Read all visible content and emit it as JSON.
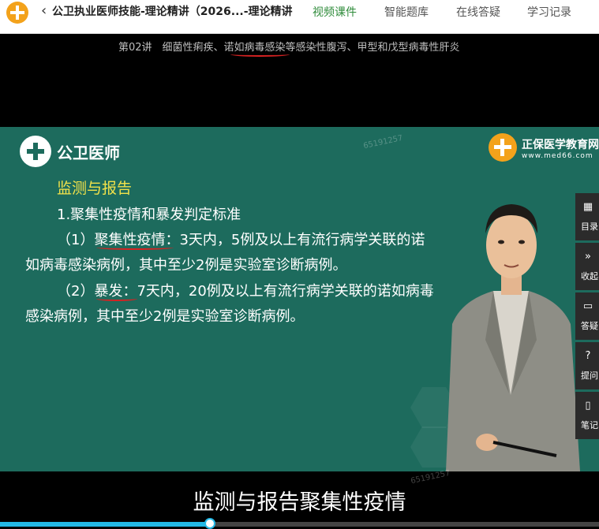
{
  "header": {
    "course_title": "公卫执业医师技能-理论精讲（2026...-理论精讲",
    "tabs": [
      {
        "label": "视频课件",
        "active": true
      },
      {
        "label": "智能题库",
        "active": false
      },
      {
        "label": "在线答疑",
        "active": false
      },
      {
        "label": "学习记录",
        "active": false
      }
    ]
  },
  "lesson": {
    "title": "第02讲　细菌性痢疾、诺如病毒感染等感染性腹泻、甲型和戊型病毒性肝炎"
  },
  "slide": {
    "brand": "公卫医师",
    "publisher_name": "正保医学教育网",
    "publisher_url": "www.med66.com",
    "watermark": "65191257",
    "heading": "监测与报告",
    "line1": "1.聚集性疫情和暴发判定标准",
    "line2": "（1）聚集性疫情：3天内，5例及以上有流行病学关联的诺",
    "line3": "如病毒感染病例，其中至少2例是实验室诊断病例。",
    "line4": "（2）暴发：7天内，20例及以上有流行病学关联的诺如病毒",
    "line5": "感染病例，其中至少2例是实验室诊断病例。"
  },
  "side_panel": [
    {
      "label": "目录",
      "icon": "grid-icon"
    },
    {
      "label": "收起",
      "icon": "collapse-icon"
    },
    {
      "label": "答疑",
      "icon": "chat-icon"
    },
    {
      "label": "提问",
      "icon": "question-icon"
    },
    {
      "label": "笔记",
      "icon": "note-icon"
    }
  ],
  "player": {
    "subtitle": "监测与报告聚集性疫情",
    "progress": 0.35
  },
  "colors": {
    "accent_green": "#2e8b3a",
    "slide_bg": "#1d6b5d",
    "heading_yellow": "#f2e24a",
    "annotation_red": "#d62222",
    "progress_blue": "#22b8e6"
  }
}
